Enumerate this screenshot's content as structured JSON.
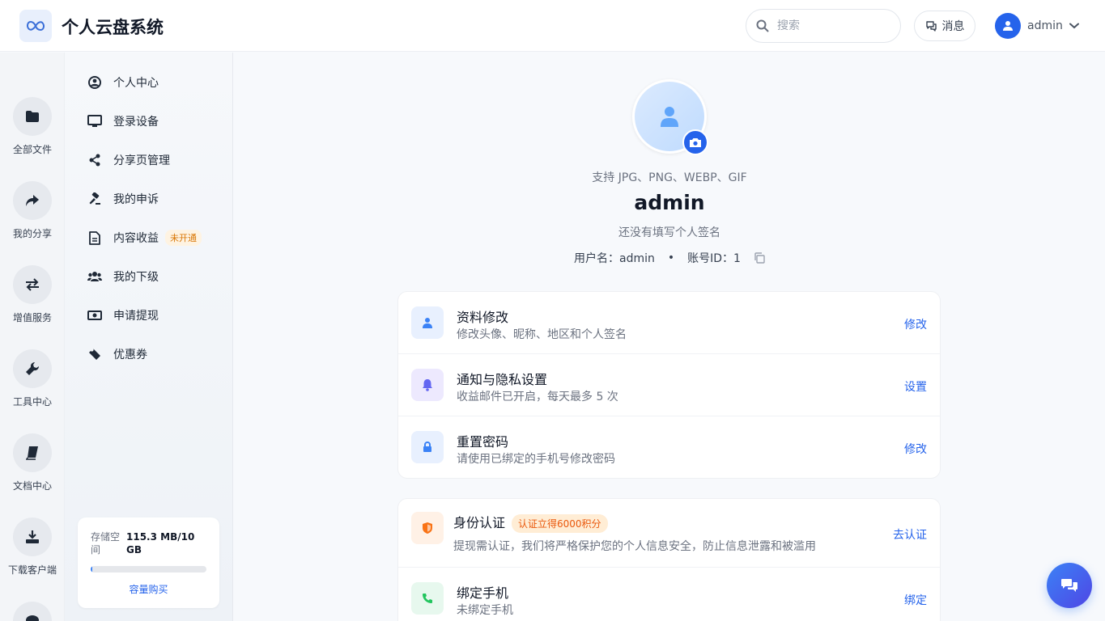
{
  "header": {
    "app_title": "个人云盘系统",
    "search_placeholder": "搜索",
    "messages_label": "消息",
    "user_name": "admin"
  },
  "rail": {
    "items": [
      {
        "label": "全部文件",
        "icon": "folder-icon"
      },
      {
        "label": "我的分享",
        "icon": "share-arrow-icon"
      },
      {
        "label": "增值服务",
        "icon": "exchange-icon"
      },
      {
        "label": "工具中心",
        "icon": "wrench-icon"
      },
      {
        "label": "文档中心",
        "icon": "book-icon"
      },
      {
        "label": "下载客户端",
        "icon": "download-icon"
      }
    ]
  },
  "sidebar": {
    "items": [
      {
        "label": "个人中心",
        "icon": "user-circle-icon"
      },
      {
        "label": "登录设备",
        "icon": "monitor-icon"
      },
      {
        "label": "分享页管理",
        "icon": "share-nodes-icon"
      },
      {
        "label": "我的申诉",
        "icon": "gavel-icon"
      },
      {
        "label": "内容收益",
        "icon": "document-icon",
        "badge": "未开通"
      },
      {
        "label": "我的下级",
        "icon": "users-icon"
      },
      {
        "label": "申请提现",
        "icon": "money-bill-icon"
      },
      {
        "label": "优惠券",
        "icon": "ticket-icon"
      }
    ],
    "storage": {
      "label": "存储空间",
      "value": "115.3 MB/10 GB",
      "used_fraction": 0.011,
      "buy_label": "容量购买"
    }
  },
  "profile": {
    "formats": "支持 JPG、PNG、WEBP、GIF",
    "name": "admin",
    "signature": "还没有填写个人签名",
    "username_text": "用户名：admin",
    "separator": "•",
    "account_id_text": "账号ID：1"
  },
  "settings_card": {
    "rows": [
      {
        "title": "资料修改",
        "subtitle": "修改头像、昵称、地区和个人签名",
        "action": "修改",
        "icon": "user-icon"
      },
      {
        "title": "通知与隐私设置",
        "subtitle": "收益邮件已开启，每天最多 5 次",
        "action": "设置",
        "icon": "bell-icon"
      },
      {
        "title": "重置密码",
        "subtitle": "请使用已绑定的手机号修改密码",
        "action": "修改",
        "icon": "lock-icon"
      }
    ]
  },
  "security_card": {
    "rows": [
      {
        "title": "身份认证",
        "badge": "认证立得6000积分",
        "subtitle": "提现需认证，我们将严格保护您的个人信息安全，防止信息泄露和被滥用",
        "action": "去认证",
        "icon": "shield-icon"
      },
      {
        "title": "绑定手机",
        "subtitle": "未绑定手机",
        "action": "绑定",
        "icon": "phone-icon"
      }
    ]
  },
  "colors": {
    "primary": "#2563eb",
    "badge_orange": "#d97706"
  }
}
